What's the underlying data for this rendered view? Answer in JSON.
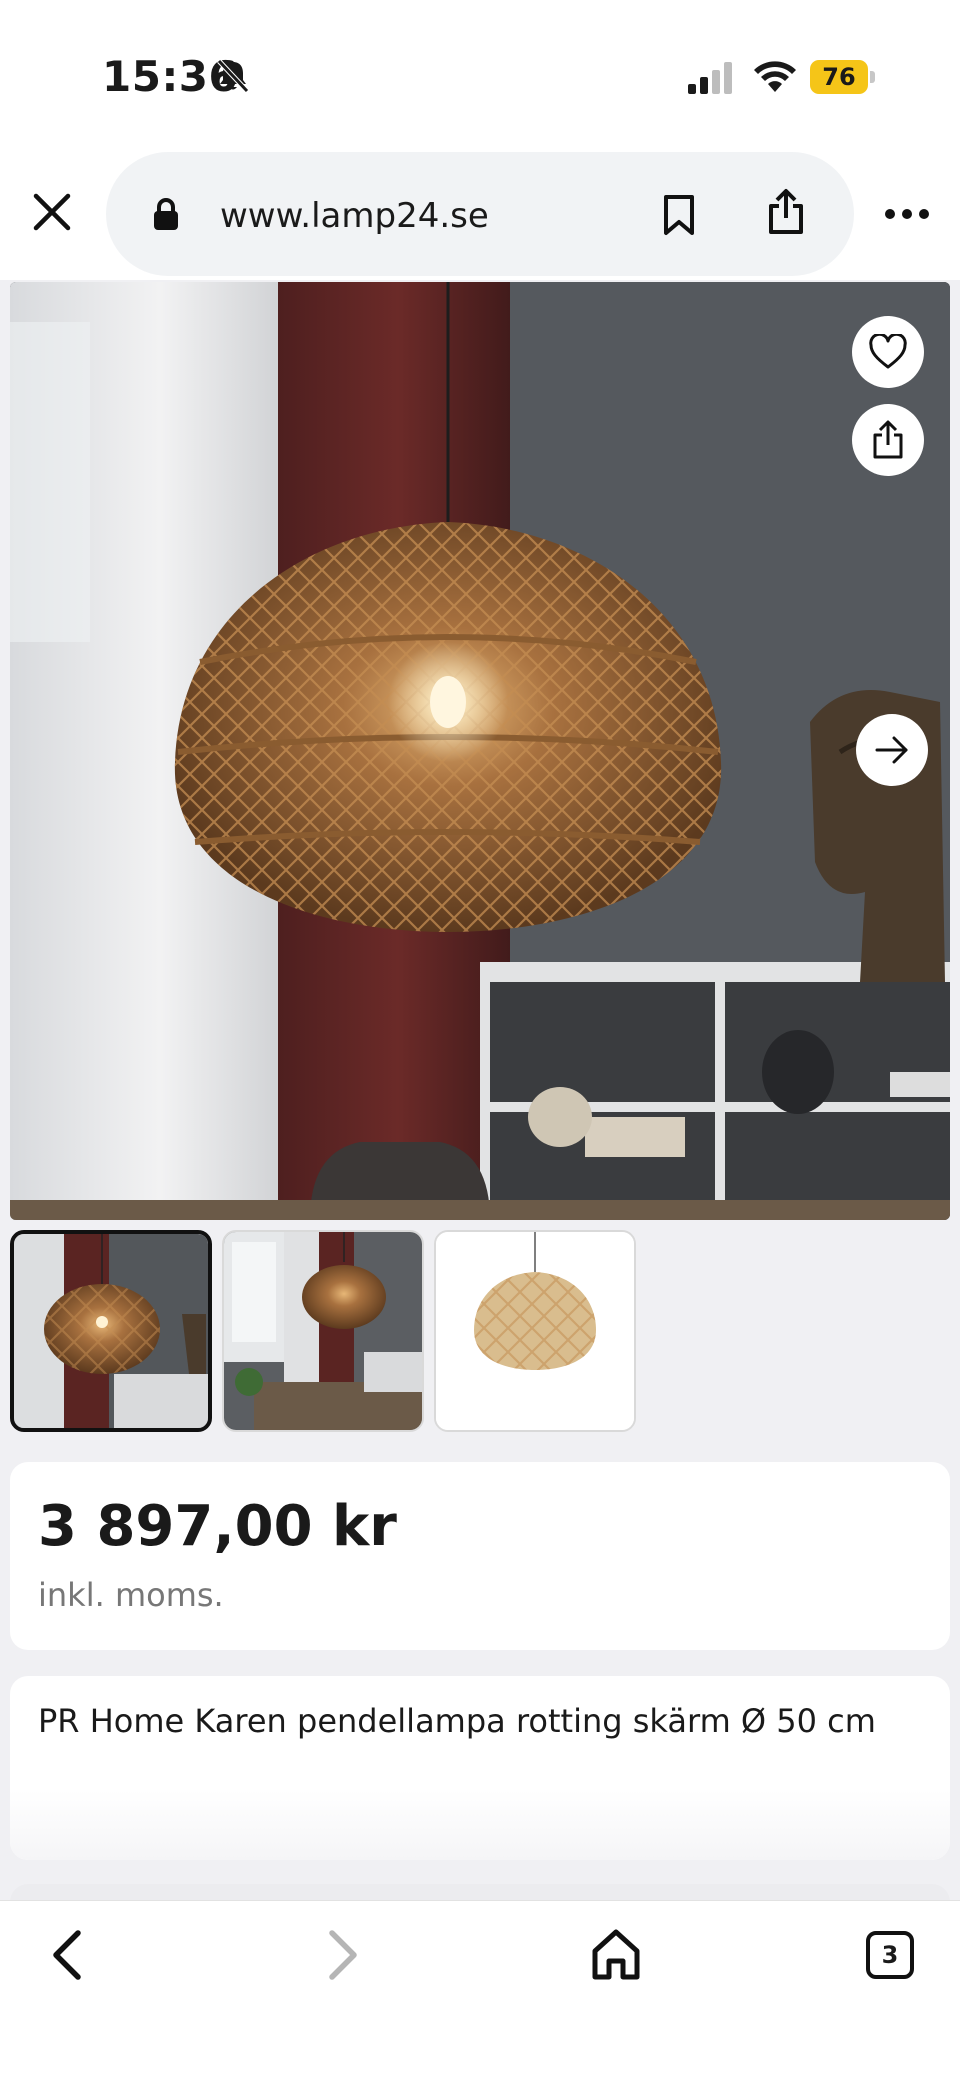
{
  "status_bar": {
    "time": "15:36",
    "battery": "76",
    "icons": [
      "bell-off-icon",
      "signal-icon",
      "wifi-icon",
      "battery-icon"
    ],
    "battery_color": "#f5c518"
  },
  "browser": {
    "url": "www.lamp24.se",
    "icons": [
      "close-icon",
      "lock-icon",
      "bookmark-icon",
      "share-icon",
      "more-icon"
    ]
  },
  "product": {
    "gallery": {
      "image_count": 3,
      "selected_index": 0,
      "icons": [
        "heart-icon",
        "share-icon",
        "arrow-right-icon"
      ]
    },
    "price": "3 897,00 kr",
    "vat_note": "inkl. moms.",
    "title": "PR Home Karen pendellampa rotting skärm Ø 50 cm"
  },
  "bottom_nav": {
    "tab_count": "3",
    "icons": [
      "back-icon",
      "forward-icon",
      "home-icon",
      "tabs-icon"
    ]
  }
}
